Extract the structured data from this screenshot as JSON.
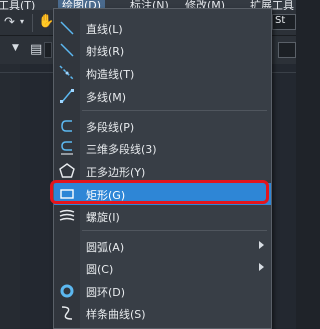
{
  "menubar": {
    "items": [
      "工具(T)",
      "绘图(D)",
      "标注(N)",
      "修改(M)",
      "扩展工具"
    ]
  },
  "toolbar": {
    "right_field_text": "St"
  },
  "draw_menu": {
    "items": [
      {
        "label": "直线(L)",
        "icon": "line-icon"
      },
      {
        "label": "射线(R)",
        "icon": "ray-icon"
      },
      {
        "label": "构造线(T)",
        "icon": "construction-line-icon"
      },
      {
        "label": "多线(M)",
        "icon": "multiline-icon"
      },
      {
        "label": "多段线(P)",
        "icon": "polyline-icon"
      },
      {
        "label": "三维多段线(3)",
        "icon": "3d-polyline-icon"
      },
      {
        "label": "正多边形(Y)",
        "icon": "polygon-icon"
      },
      {
        "label": "矩形(G)",
        "icon": "rectangle-icon",
        "highlighted": true
      },
      {
        "label": "螺旋(I)",
        "icon": "helix-icon"
      },
      {
        "label": "圆弧(A)",
        "submenu": true
      },
      {
        "label": "圆(C)",
        "submenu": true
      },
      {
        "label": "圆环(D)",
        "icon": "donut-icon"
      },
      {
        "label": "样条曲线(S)",
        "icon": "spline-icon"
      }
    ]
  },
  "colors": {
    "highlight": "#2e86d6",
    "annotation_ring": "#e3151d"
  }
}
